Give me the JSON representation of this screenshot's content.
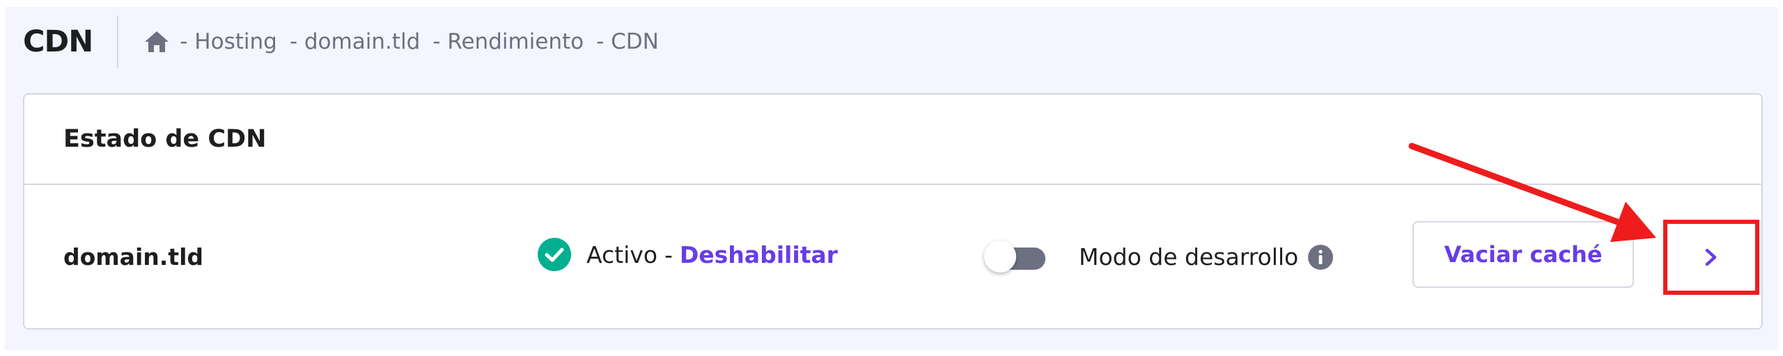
{
  "header": {
    "title": "CDN",
    "breadcrumb": [
      "- Hosting",
      "- domain.tld",
      "- Rendimiento",
      "- CDN"
    ]
  },
  "card": {
    "title": "Estado de CDN",
    "domain": "domain.tld",
    "status": {
      "label": "Activo",
      "separator": "-",
      "action_label": "Deshabilitar"
    },
    "dev_mode": {
      "label": "Modo de desarrollo",
      "enabled": false
    },
    "purge_label": "Vaciar caché"
  },
  "icons": {
    "home": "home-icon",
    "check": "check-circle-icon",
    "info": "info-icon",
    "chevron": "chevron-right-icon"
  },
  "colors": {
    "accent": "#673de6",
    "success": "#00b090",
    "highlight": "#ee1c1c",
    "background": "#f4f5ff",
    "toggle_off": "#6d7081"
  }
}
